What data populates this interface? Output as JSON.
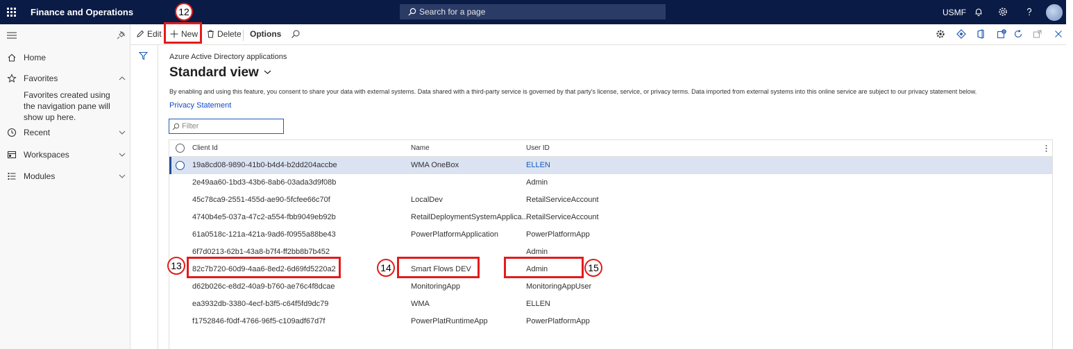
{
  "app": {
    "title": "Finance and Operations",
    "search_placeholder": "Search for a page",
    "company": "USMF"
  },
  "nav": {
    "home": "Home",
    "favorites": "Favorites",
    "favorites_hint": "Favorites created using the navigation pane will show up here.",
    "recent": "Recent",
    "workspaces": "Workspaces",
    "modules": "Modules"
  },
  "toolbar": {
    "edit": "Edit",
    "new": "New",
    "delete": "Delete",
    "options": "Options"
  },
  "page": {
    "breadcrumb": "Azure Active Directory applications",
    "view_title": "Standard view",
    "consent_text": "By enabling and using this feature, you consent to share your data with external systems. Data shared with a third-party service is governed by that party's license, service, or privacy terms. Data imported from external systems into this online service are subject to our privacy statement below.",
    "privacy_link": "Privacy Statement",
    "filter_placeholder": "Filter"
  },
  "grid": {
    "columns": [
      "Client Id",
      "Name",
      "User ID"
    ],
    "rows": [
      {
        "client_id": "19a8cd08-9890-41b0-b4d4-b2dd204accbe",
        "name": "WMA OneBox",
        "user_id": "ELLEN",
        "selected": true
      },
      {
        "client_id": "2e49aa60-1bd3-43b6-8ab6-03ada3d9f08b",
        "name": "",
        "user_id": "Admin"
      },
      {
        "client_id": "45c78ca9-2551-455d-ae90-5fcfee66c70f",
        "name": "LocalDev",
        "user_id": "RetailServiceAccount"
      },
      {
        "client_id": "4740b4e5-037a-47c2-a554-fbb9049eb92b",
        "name": "RetailDeploymentSystemApplica...",
        "user_id": "RetailServiceAccount"
      },
      {
        "client_id": "61a0518c-121a-421a-9ad6-f0955a88be43",
        "name": "PowerPlatformApplication",
        "user_id": "PowerPlatformApp"
      },
      {
        "client_id": "6f7d0213-62b1-43a8-b7f4-ff2bb8b7b452",
        "name": "",
        "user_id": "Admin"
      },
      {
        "client_id": "82c7b720-60d9-4aa6-8ed2-6d69fd5220a2",
        "name": "Smart Flows DEV",
        "user_id": "Admin"
      },
      {
        "client_id": "d62b026c-e8d2-40a9-b760-ae76c4f8dcae",
        "name": "MonitoringApp",
        "user_id": "MonitoringAppUser"
      },
      {
        "client_id": "ea3932db-3380-4ecf-b3f5-c64f5fd9dc79",
        "name": "WMA",
        "user_id": "ELLEN"
      },
      {
        "client_id": "f1752846-f0df-4766-96f5-c109adf67d7f",
        "name": "PowerPlatRuntimeApp",
        "user_id": "PowerPlatformApp"
      }
    ]
  },
  "callouts": {
    "new_button": "12",
    "client_id_cell": "13",
    "name_cell": "14",
    "user_id_cell": "15"
  },
  "colors": {
    "topbar": "#0a1b45",
    "accent": "#1e4f9c",
    "callout": "#e31b1b"
  }
}
